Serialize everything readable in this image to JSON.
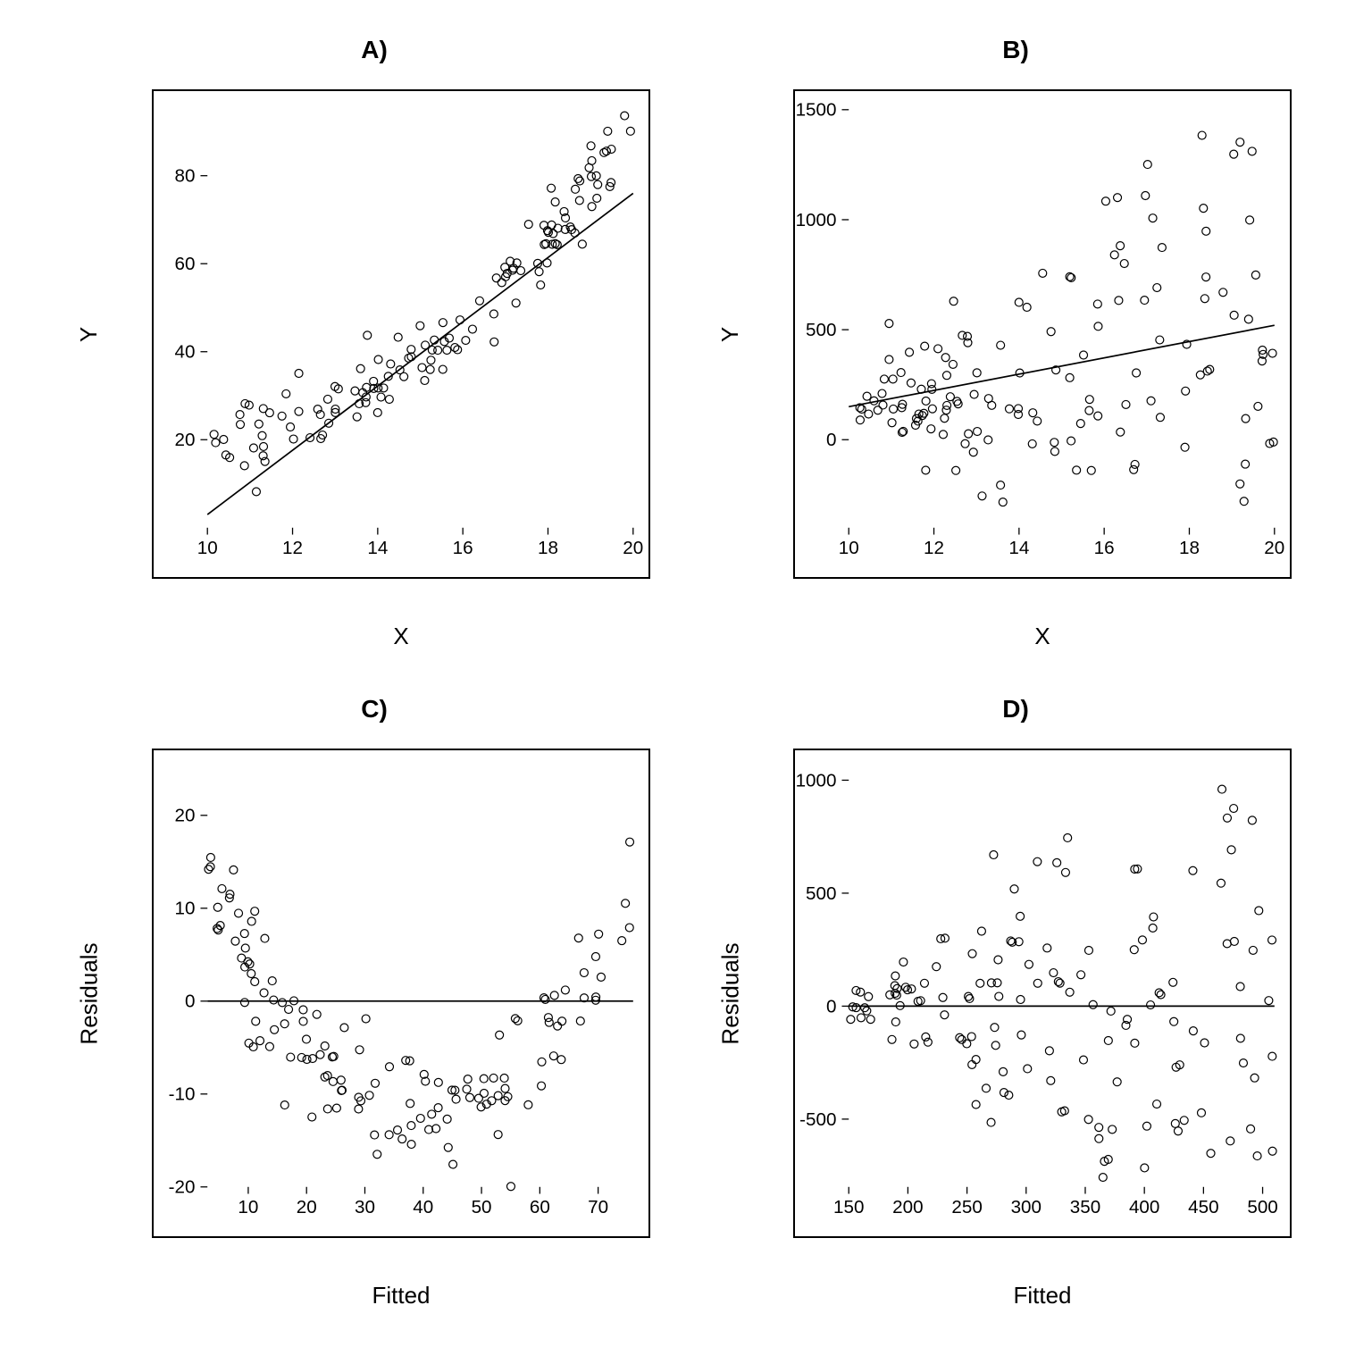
{
  "chart_data": [
    {
      "id": "A",
      "type": "scatter",
      "title": "A)",
      "xlabel": "X",
      "ylabel": "Y",
      "xlim": [
        10,
        20
      ],
      "ylim": [
        0,
        95
      ],
      "xticks": [
        10,
        12,
        14,
        16,
        18,
        20
      ],
      "yticks": [
        20,
        40,
        60,
        80
      ],
      "line": {
        "x1": 10,
        "y1": 3,
        "x2": 20,
        "y2": 76
      },
      "n": 140,
      "gen": "curved"
    },
    {
      "id": "B",
      "type": "scatter",
      "title": "B)",
      "xlabel": "X",
      "ylabel": "Y",
      "xlim": [
        10,
        20
      ],
      "ylim": [
        -400,
        1500
      ],
      "xticks": [
        10,
        12,
        14,
        16,
        18,
        20
      ],
      "yticks": [
        0,
        500,
        1000,
        1500
      ],
      "line": {
        "x1": 10,
        "y1": 150,
        "x2": 20,
        "y2": 520
      },
      "n": 150,
      "gen": "fan"
    },
    {
      "id": "C",
      "type": "scatter",
      "title": "C)",
      "xlabel": "Fitted",
      "ylabel": "Residuals",
      "xlim": [
        3,
        76
      ],
      "ylim": [
        -20,
        25
      ],
      "xticks": [
        10,
        20,
        30,
        40,
        50,
        60,
        70
      ],
      "yticks": [
        -20,
        -10,
        0,
        10,
        20
      ],
      "hline": 0,
      "n": 140,
      "gen": "ures"
    },
    {
      "id": "D",
      "type": "scatter",
      "title": "D)",
      "xlabel": "Fitted",
      "ylabel": "Residuals",
      "xlim": [
        150,
        510
      ],
      "ylim": [
        -800,
        1050
      ],
      "xticks": [
        150,
        200,
        250,
        300,
        350,
        400,
        450,
        500
      ],
      "yticks": [
        -500,
        0,
        500,
        1000
      ],
      "hline": 0,
      "n": 150,
      "gen": "fanres"
    }
  ]
}
